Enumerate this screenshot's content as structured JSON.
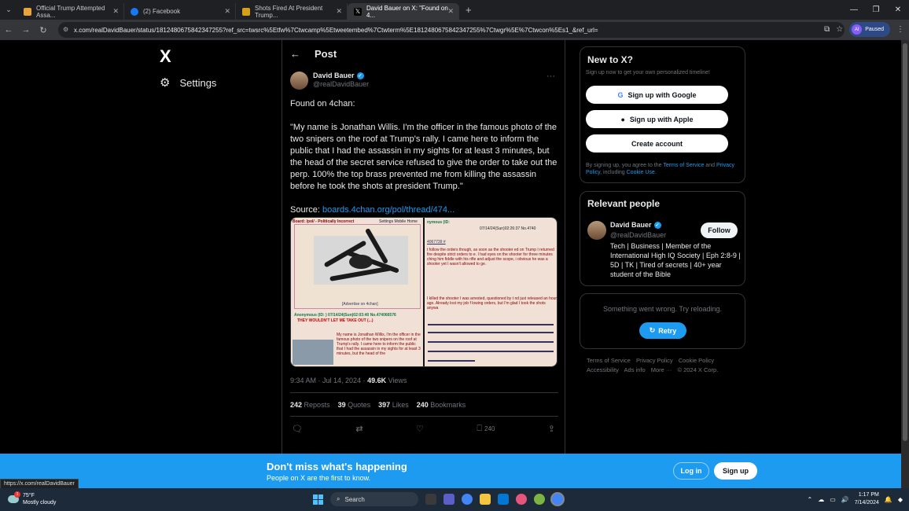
{
  "browser": {
    "tabs": [
      {
        "title": "Official Trump Attempted Assa...",
        "color": "#e8a33d"
      },
      {
        "title": "(2) Facebook",
        "color": "#1877f2"
      },
      {
        "title": "Shots Fired At President Trump...",
        "color": "#d4a017"
      },
      {
        "title": "David Bauer on X: \"Found on 4...",
        "color": "#000000"
      }
    ],
    "url": "x.com/realDavidBauer/status/1812480675842347255?ref_src=twsrc%5Etfw%7Ctwcamp%5Etweetembed%7Ctwterm%5E1812480675842347255%7Ctwgr%5E%7Ctwcon%5Es1_&ref_url=",
    "profile_badge": "Paused",
    "profile_initials": "AI",
    "status_url": "https://x.com/realDavidBauer"
  },
  "nav": {
    "logo": "X",
    "settings_label": "Settings"
  },
  "post": {
    "header": "Post",
    "author_name": "David Bauer",
    "author_handle": "@realDavidBauer",
    "text_1": "Found on 4chan:",
    "text_2": "\"My name is Jonathan Willis. I'm the officer in the famous photo of the two snipers on the roof at Trump's rally. I came here to inform the public that I had the assassin in my sights for at least 3 minutes, but the head of the secret service refused to give the order to take out the perp. 100% the top brass prevented me from killing the assassin before he took the shots at president Trump.\"",
    "source_label": "Source:",
    "source_link": "boards.4chan.org/pol/thread/474...",
    "time": "9:34 AM · Jul 14, 2024 · ",
    "views_count": "49.6K",
    "views_label": " Views",
    "reposts": "242",
    "reposts_label": "Reposts",
    "quotes": "39",
    "quotes_label": "Quotes",
    "likes": "397",
    "likes_label": "Likes",
    "bookmarks": "240",
    "bookmarks_label": "Bookmarks",
    "bookmark_action_count": "240"
  },
  "media": {
    "left_header": "Board: /pol/ - Politically Incorrect",
    "left_nav": "Settings Mobile Home",
    "left_footer": "[Advertise on 4chan]",
    "anon_line": "Anonymous (ID: ) 07/14/24(Sun)02:03:40 No.474066576",
    "red_title": "THEY WOULDN'T LET ME TAKE OUT (...)",
    "left_text": "My name is Jonathan Willis, I'm the officer in the famous photo of the two snipers on the roof at Trump's rally. I came here to inform the public that I had the assassin in my sights for at least 3 minutes, but the head of the",
    "right_anon": "nymous (ID:",
    "right_date": "07/14/24(Sun)02:26:37 No.4740",
    "right_post": "4067739 #",
    "right_text": "t follow the orders though, as soon as the shooter ed on Trump I returned fire despite strict orders to e. I had eyes on the shooter for three minutes ching him fiddle with his rifle and adjust the scope, i obvious he was a shooter yet I wasn't allowed to ge.",
    "right_text_2": "I killed the shooter I was arrested, questioned by t nd just released an hour ago. Already lost my job f lowing orders, but I'm glad I took the shots anywa"
  },
  "sidebar": {
    "newx_title": "New to X?",
    "newx_sub": "Sign up now to get your own personalized timeline!",
    "google_btn": "Sign up with Google",
    "apple_btn": "Sign up with Apple",
    "create_btn": "Create account",
    "legal_1": "By signing up, you agree to the ",
    "legal_tos": "Terms of Service",
    "legal_2": " and ",
    "legal_privacy": "Privacy Policy",
    "legal_3": ", including ",
    "legal_cookie": "Cookie Use.",
    "relevant_title": "Relevant people",
    "person_name": "David Bauer",
    "person_handle": "@realDavidBauer",
    "follow_btn": "Follow",
    "person_bio": "Tech | Business | Member of the International High IQ Society | Eph 2:8-9 | 5D | TK | Tired of secrets | 40+ year student of the Bible",
    "error_text": "Something went wrong. Try reloading.",
    "retry_btn": "Retry",
    "footer": [
      "Terms of Service",
      "Privacy Policy",
      "Cookie Policy",
      "Accessibility",
      "Ads info",
      "More ···",
      "© 2024 X Corp."
    ]
  },
  "banner": {
    "title": "Don't miss what's happening",
    "subtitle": "People on X are the first to know.",
    "login": "Log in",
    "signup": "Sign up"
  },
  "taskbar": {
    "temp": "75°F",
    "weather": "Mostly cloudy",
    "weather_badge": "1",
    "search": "Search",
    "time": "1:17 PM",
    "date": "7/14/2024"
  },
  "colors": {
    "accent": "#1d9bf0",
    "background": "#000000",
    "muted": "#71767b"
  }
}
